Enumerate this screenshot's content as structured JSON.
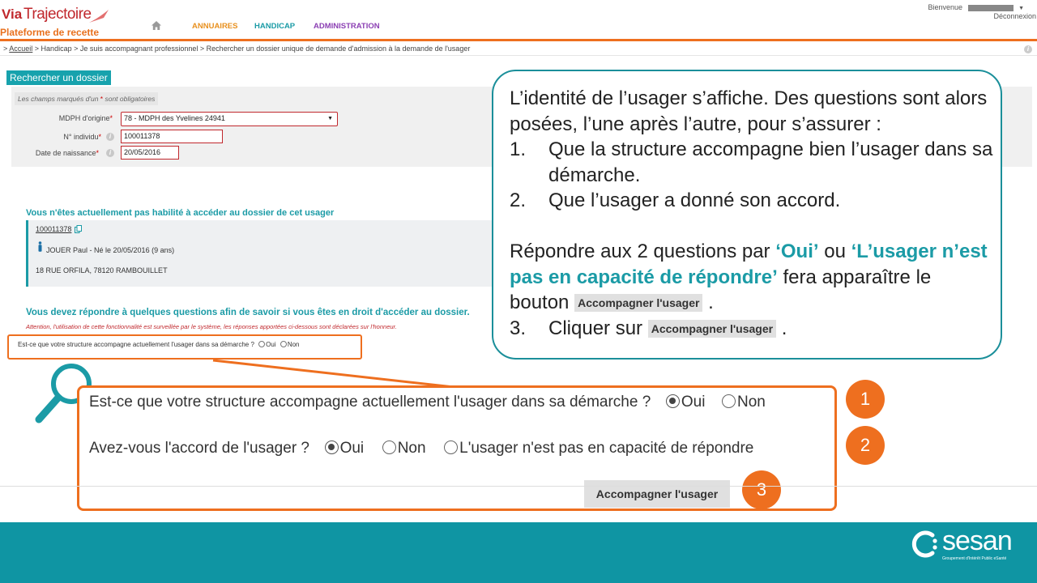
{
  "header": {
    "logo_via": "Via",
    "logo_traj": "Trajectoire",
    "platform": "Plateforme de recette",
    "nav": [
      "ANNUAIRES",
      "HANDICAP",
      "ADMINISTRATION"
    ],
    "welcome": "Bienvenue",
    "logout": "Déconnexion"
  },
  "breadcrumb": {
    "prefix": ">",
    "home": "Accueil",
    "rest": " > Handicap > Je suis accompagnant professionnel > Rechercher un dossier unique de demande d'admission à la demande de l'usager"
  },
  "search": {
    "title": "Rechercher un dossier",
    "required_note_a": "Les champs marqués d'un ",
    "required_note_star": "*",
    "required_note_b": " sont obligatoires",
    "mdph_label": "MDPH d'origine",
    "mdph_value": "78 - MDPH des Yvelines 24941",
    "individu_label": "N° individu",
    "individu_value": "100011378",
    "dob_label": "Date de naissance",
    "dob_value": "20/05/2016",
    "star": "*",
    "info": "i"
  },
  "patient": {
    "not_authorized": "Vous n'êtes actuellement pas habilité à accéder au dossier de cet usager",
    "id": "100011378",
    "name_line": "JOUER Paul - Né le 20/05/2016 (9 ans)",
    "address": "18 RUE ORFILA, 78120 RAMBOUILLET"
  },
  "questions": {
    "title": "Vous devez répondre à quelques questions afin de savoir si vous êtes en droit d'accéder au dossier.",
    "warning": "Attention, l'utilisation de cette fonctionnalité est surveillée par le système, les réponses apportées ci-dessous sont déclarées sur l'honneur.",
    "small_q1": "Est-ce que votre structure accompagne actuellement l'usager dans sa démarche ?",
    "small_oui": "Oui",
    "small_non": "Non"
  },
  "zoom": {
    "q1": "Est-ce que votre structure accompagne actuellement l'usager dans sa démarche ?",
    "q1_oui": "Oui",
    "q1_non": "Non",
    "q1_selected": "Oui",
    "q2": "Avez-vous l'accord de l'usager ?",
    "q2_oui": "Oui",
    "q2_non": "Non",
    "q2_incapable": "L'usager n'est pas en capacité de répondre",
    "q2_selected": "Oui",
    "button": "Accompagner l'usager",
    "steps": [
      "1",
      "2",
      "3"
    ]
  },
  "callout": {
    "line1": "L’identité de l’usager s’affiche. Des questions sont alors posées, l’une après l’autre, pour s’assurer :",
    "item1_num": "1.",
    "item1": "Que la structure accompagne bien l’usager dans sa démarche.",
    "item2_num": "2.",
    "item2": "Que l’usager a donné son accord.",
    "p2_a": "Répondre aux 2 questions par ",
    "p2_oui": "‘Oui’",
    "p2_ou": " ou ",
    "p2_incap": "‘L’usager n’est pas en capacité de répondre’",
    "p2_b": " fera apparaître le bouton ",
    "p2_btn": "Accompagner l'usager",
    "p2_end": " .",
    "item3_num": "3.",
    "item3_a": "Cliquer sur ",
    "item3_btn": "Accompagner l'usager",
    "item3_end": " ."
  },
  "footer": {
    "brand": "sesan",
    "tagline": "Groupement d'Intérêt Public eSanté"
  },
  "colors": {
    "orange": "#ee6f1f",
    "teal": "#1b9ba6",
    "footer": "#0f95a3",
    "purple": "#8b3fb3",
    "red": "#c0282d"
  }
}
